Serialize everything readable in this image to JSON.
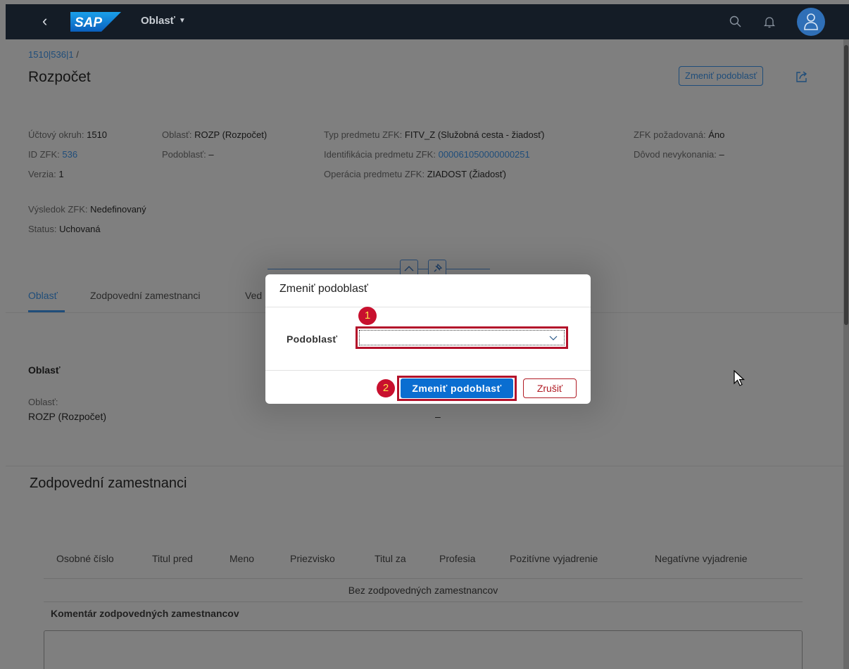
{
  "shell": {
    "logo_text": "SAP",
    "app_title": "Oblasť",
    "icons": [
      "back-icon",
      "search-icon",
      "bell-icon",
      "user-icon"
    ]
  },
  "header": {
    "breadcrumb": "1510|536|1",
    "breadcrumb_sep": "/",
    "title": "Rozpočet",
    "change_button": "Zmeniť podoblasť"
  },
  "attributes": {
    "col1": [
      {
        "label": "Účtový okruh:",
        "value": "1510",
        "link": false
      },
      {
        "label": "ID ZFK:",
        "value": "536",
        "link": true
      },
      {
        "label": "Verzia:",
        "value": "1",
        "link": false
      }
    ],
    "col2": [
      {
        "label": "Oblasť:",
        "value": "ROZP (Rozpočet)",
        "link": false
      },
      {
        "label": "Podoblasť:",
        "value": "–",
        "link": false
      }
    ],
    "col3": [
      {
        "label": "Typ predmetu ZFK:",
        "value": "FITV_Z (Služobná cesta - žiadosť)",
        "link": false
      },
      {
        "label": "Identifikácia predmetu ZFK:",
        "value": "000061050000000251",
        "link": true
      },
      {
        "label": "Operácia predmetu ZFK:",
        "value": "ZIADOST (Žiadosť)",
        "link": false
      }
    ],
    "col4": [
      {
        "label": "ZFK požadovaná:",
        "value": "Áno",
        "link": false
      },
      {
        "label": "Dôvod nevykonania:",
        "value": "–",
        "link": false
      }
    ],
    "result": {
      "label": "Výsledok ZFK:",
      "value": "Nedefinovaný"
    },
    "status": {
      "label": "Status:",
      "value": "Uchovaná"
    }
  },
  "tabs": [
    "Oblasť",
    "Zodpovední zamestnanci",
    "Ved"
  ],
  "section_area": {
    "title": "Oblasť",
    "field_label": "Oblasť:",
    "field_value": "ROZP (Rozpočet)",
    "second_value": "–"
  },
  "section_staff": {
    "title": "Zodpovední zamestnanci",
    "columns": [
      "Osobné číslo",
      "Titul pred",
      "Meno",
      "Priezvisko",
      "Titul za",
      "Profesia",
      "Pozitívne vyjadrenie",
      "Negatívne vyjadrenie"
    ],
    "no_data": "Bez zodpovedných zamestnancov",
    "comment_label": "Komentár zodpovedných zamestnancov"
  },
  "dialog": {
    "title": "Zmeniť podoblasť",
    "field_label": "Podoblasť",
    "field_value": "",
    "confirm_button": "Zmeniť podoblasť",
    "cancel_button": "Zrušiť",
    "markers": [
      "1",
      "2"
    ]
  },
  "colors": {
    "shell": "#141c26",
    "primary": "#0a6ed1",
    "highlight": "#b3112a",
    "cancel": "#b01b24"
  }
}
